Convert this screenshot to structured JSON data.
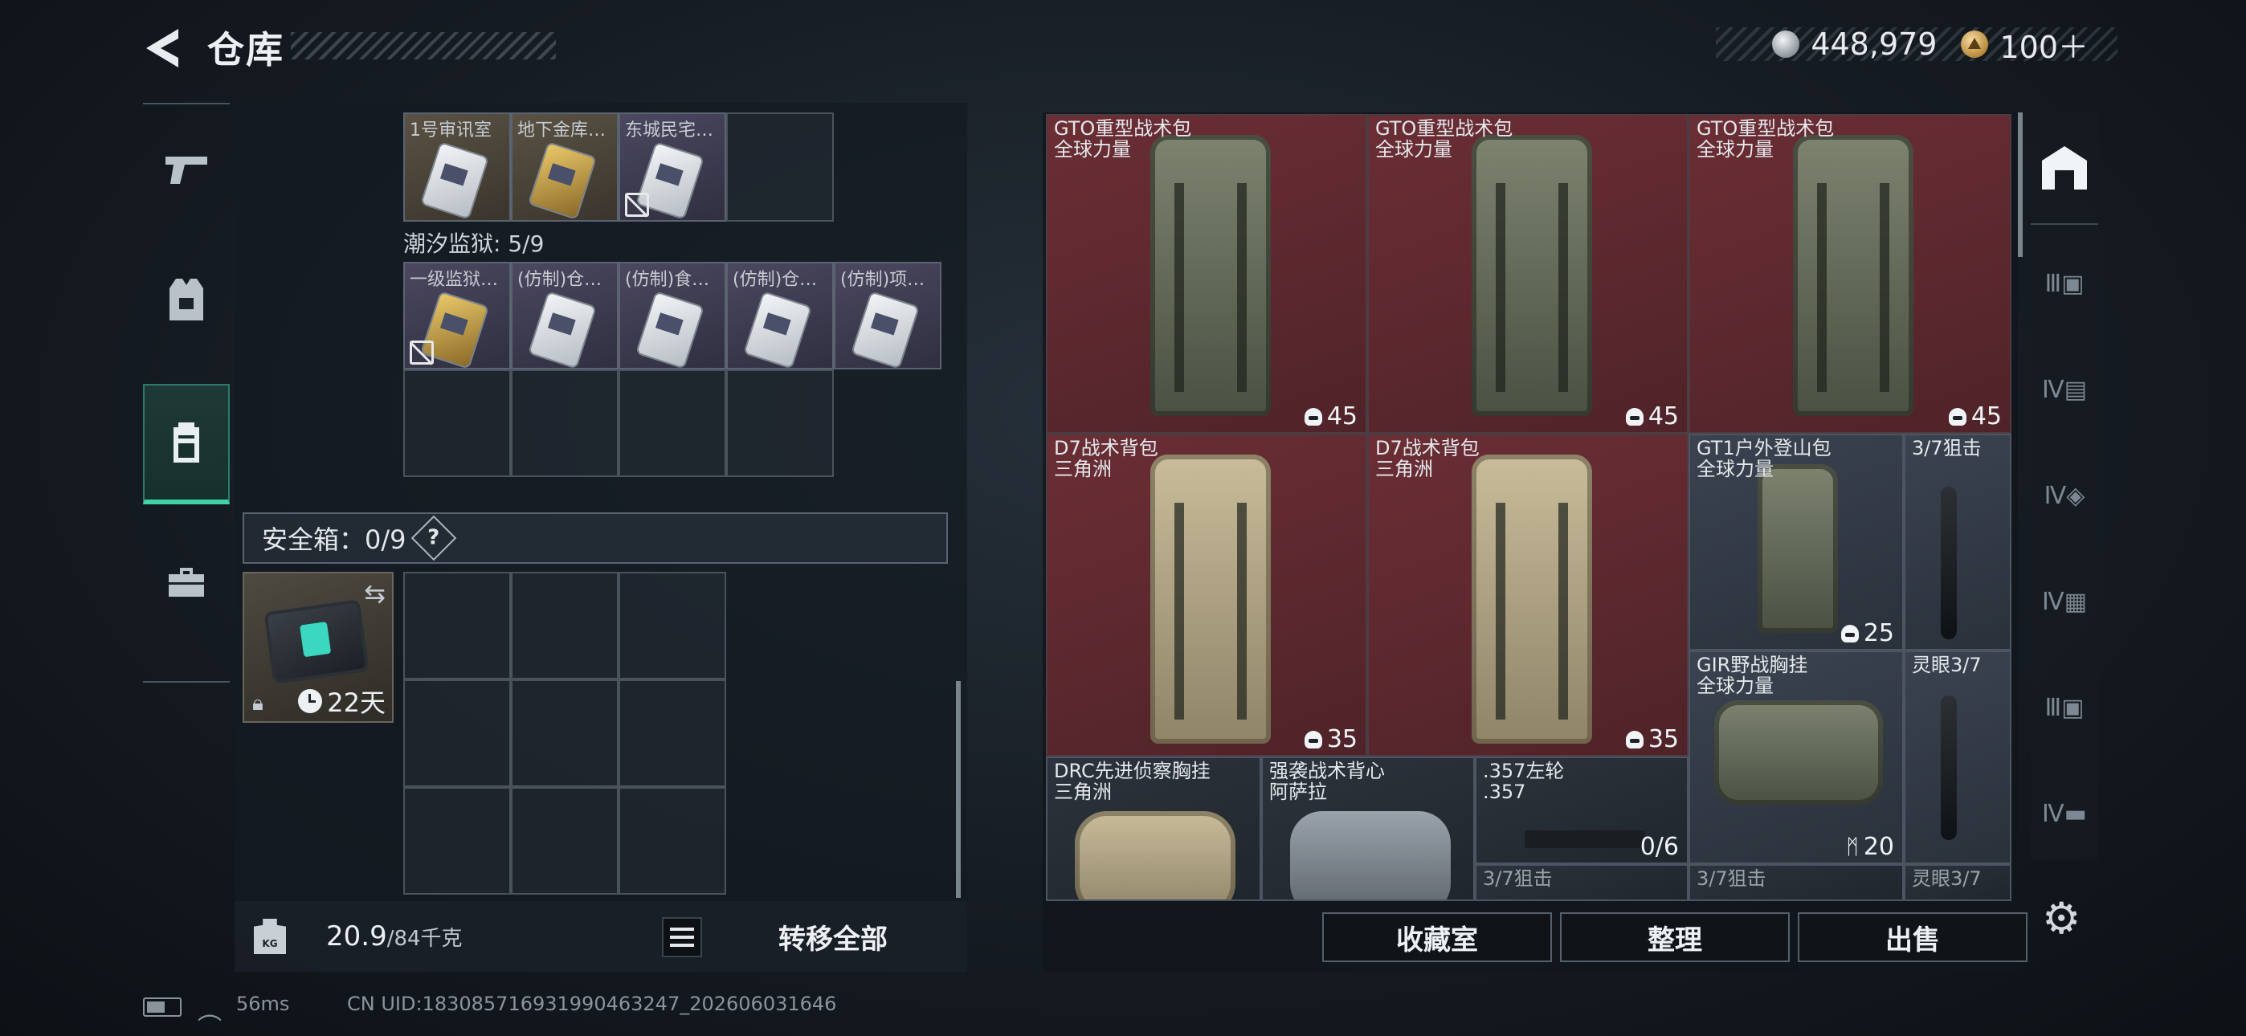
{
  "header": {
    "title": "仓库",
    "currency": [
      {
        "icon": "silver-coin-icon",
        "value": "448,979"
      },
      {
        "icon": "gold-coin-icon",
        "value": "100＋"
      }
    ]
  },
  "left_rail": {
    "tabs": [
      {
        "name": "weapons",
        "icon": "pistol-icon"
      },
      {
        "name": "gear",
        "icon": "vest-icon"
      },
      {
        "name": "storage",
        "icon": "backpack-icon",
        "active": true
      },
      {
        "name": "supplies",
        "icon": "toolbox-icon"
      }
    ]
  },
  "storage": {
    "top_row": [
      {
        "label": "1号审讯室",
        "style": "tan",
        "card": "silver"
      },
      {
        "label": "地下金库…",
        "style": "tan",
        "card": "gold"
      },
      {
        "label": "东城民宅…",
        "style": "purple",
        "card": "silver",
        "no_carry": true
      }
    ],
    "prison": {
      "title": "潮汐监狱: 5/9",
      "items": [
        {
          "label": "一级监狱…",
          "card": "gold",
          "no_carry": true
        },
        {
          "label": "(仿制)仓…",
          "card": "silver"
        },
        {
          "label": "(仿制)食…",
          "card": "silver"
        },
        {
          "label": "(仿制)仓…",
          "card": "silver"
        },
        {
          "label": "(仿制)项…",
          "card": "silver"
        }
      ]
    },
    "safe_box": {
      "title": "安全箱：0/9",
      "help": "?",
      "timer": "22天",
      "swap_icon": "swap-icon",
      "lock_icon": "lock-icon"
    },
    "weight": {
      "current": "20.9",
      "max": "/84千克"
    },
    "transfer_all": "转移全部"
  },
  "inventory": {
    "items": [
      {
        "name": "GTO重型战术包",
        "sub": "全球力量",
        "qty": "45",
        "qty_icon": "helmet-icon",
        "style": "red",
        "art": "bag-green"
      },
      {
        "name": "GTO重型战术包",
        "sub": "全球力量",
        "qty": "45",
        "qty_icon": "helmet-icon",
        "style": "red",
        "art": "bag-green"
      },
      {
        "name": "GTO重型战术包",
        "sub": "全球力量",
        "qty": "45",
        "qty_icon": "helmet-icon",
        "style": "red",
        "art": "bag-green"
      },
      {
        "name": "D7战术背包",
        "sub": "三角洲",
        "qty": "35",
        "qty_icon": "helmet-icon",
        "style": "red",
        "art": "bag-tan"
      },
      {
        "name": "D7战术背包",
        "sub": "三角洲",
        "qty": "35",
        "qty_icon": "helmet-icon",
        "style": "red",
        "art": "bag-tan"
      },
      {
        "name": "GT1户外登山包",
        "sub": "全球力量",
        "qty": "25",
        "qty_icon": "helmet-icon",
        "style": "gray",
        "art": "bag-green"
      },
      {
        "name": "3/7狙击",
        "sub": "",
        "qty": "",
        "style": "gray",
        "art": "scope"
      },
      {
        "name": "GIR野战胸挂",
        "sub": "全球力量",
        "qty": "20",
        "qty_icon": "vest-small-icon",
        "style": "gray",
        "art": "bag-green"
      },
      {
        "name": "灵眼3/7",
        "sub": "",
        "qty": "",
        "style": "gray",
        "art": "scope"
      },
      {
        "name": "DRC先进侦察胸挂",
        "sub": "三角洲",
        "qty": "",
        "style": "dark",
        "art": "bag-tan"
      },
      {
        "name": "强袭战术背心",
        "sub": "阿萨拉",
        "qty": "",
        "style": "dark",
        "art": "bag-gray"
      },
      {
        "name": ".357左轮",
        "sub": ".357",
        "qty": "0/6",
        "style": "dark",
        "art": "revolver"
      },
      {
        "name": "3/7狙击",
        "sub": "",
        "qty": "",
        "style": "dark",
        "art": "none"
      },
      {
        "name": "3/7狙击",
        "sub": "",
        "qty": "",
        "style": "dark",
        "art": "none"
      },
      {
        "name": "灵眼3/7",
        "sub": "",
        "qty": "",
        "style": "dark",
        "art": "none"
      }
    ],
    "buttons": {
      "collection": "收藏室",
      "organize": "整理",
      "sell": "出售"
    }
  },
  "right_tabs": [
    {
      "icon": "home-icon",
      "active": true
    },
    {
      "icon": "case-tier-3-icon"
    },
    {
      "icon": "case-tier-4-icon"
    },
    {
      "icon": "case-tier-4-icon"
    },
    {
      "icon": "case-tier-4-icon"
    },
    {
      "icon": "case-tier-3-icon"
    },
    {
      "icon": "case-tier-4-icon"
    }
  ],
  "status": {
    "ping": "56ms",
    "uid": "CN UID:18308571693199046324​7_202606031646"
  },
  "colors": {
    "accent": "#3fd3a6",
    "rare": "#6b2e35"
  }
}
